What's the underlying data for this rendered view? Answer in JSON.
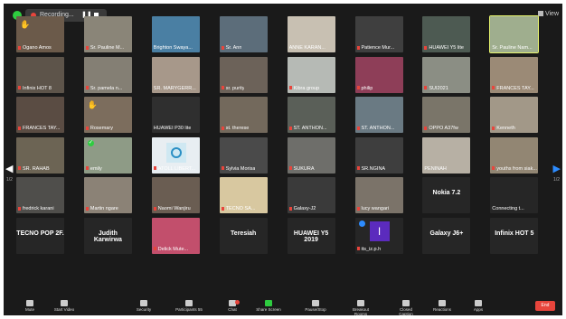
{
  "topbar": {
    "recording_label": "Recording...",
    "pause_glyph": "❚❚",
    "view_label": "View"
  },
  "participants": [
    {
      "name": "Ogano Amos",
      "muted": true,
      "bg": "#6b5a4a",
      "hand": true
    },
    {
      "name": "Sr. Pauline M...",
      "muted": true,
      "bg": "#8a8578"
    },
    {
      "name": "Brighton Swaya...",
      "muted": false,
      "bg": "#4a7fa3"
    },
    {
      "name": "Sr. Ann",
      "muted": true,
      "bg": "#5c6d7a"
    },
    {
      "name": "ANNE KARAN...",
      "muted": false,
      "bg": "#c8c0b2"
    },
    {
      "name": "Patience Mur...",
      "muted": true,
      "bg": "#3f3f3f"
    },
    {
      "name": "HUAWEI Y5 lite",
      "muted": true,
      "bg": "#4d5a52"
    },
    {
      "name": "Sr. Pauline Nam...",
      "muted": false,
      "bg": "#9fae8e",
      "highlight": true
    },
    {
      "name": "Infinix HOT 8",
      "muted": true,
      "bg": "#5d544a"
    },
    {
      "name": "Sr. pamela n...",
      "muted": true,
      "bg": "#847f74"
    },
    {
      "name": "SR. MARYGERR...",
      "muted": false,
      "bg": "#a7988a"
    },
    {
      "name": "sr. purity",
      "muted": true,
      "bg": "#6c6259"
    },
    {
      "name": "Kibra group",
      "muted": true,
      "bg": "#b6bab5"
    },
    {
      "name": "philip",
      "muted": true,
      "bg": "#8e3e58"
    },
    {
      "name": "SUI2021",
      "muted": true,
      "bg": "#8b8e84"
    },
    {
      "name": "FRANCES TAY...",
      "muted": true,
      "bg": "#9b8a76"
    },
    {
      "name": "FRANCES TAY...",
      "muted": true,
      "bg": "#5a4c43"
    },
    {
      "name": "Rosemary",
      "muted": true,
      "bg": "#7c6d5d",
      "hand": true
    },
    {
      "name": "HUAWEI P30 lite",
      "muted": false,
      "bg": "#2f2f2f"
    },
    {
      "name": "st. therese",
      "muted": true,
      "bg": "#73695c"
    },
    {
      "name": "ST. ANTHON...",
      "muted": true,
      "bg": "#5a5f58"
    },
    {
      "name": "ST. ANTHON...",
      "muted": true,
      "bg": "#6a7a83"
    },
    {
      "name": "OPPO A37fw",
      "muted": true,
      "bg": "#7a7569"
    },
    {
      "name": "Kenneth",
      "muted": true,
      "bg": "#a29888"
    },
    {
      "name": "SR. RAHAB",
      "muted": true,
      "bg": "#6c6454"
    },
    {
      "name": "emily",
      "muted": true,
      "bg": "#8e9b86",
      "check": true
    },
    {
      "name": "ATOLL LIBERT...",
      "muted": true,
      "bg": "#e8eef2",
      "qr": true
    },
    {
      "name": "Sylvia Morisa",
      "muted": true,
      "bg": "#4a4a4a"
    },
    {
      "name": "SUKURA",
      "muted": true,
      "bg": "#6e6e6a"
    },
    {
      "name": "SR.NGINA",
      "muted": true,
      "bg": "#3e3e3e"
    },
    {
      "name": "PENINAH",
      "muted": false,
      "bg": "#b7b0a4"
    },
    {
      "name": "youths from siak...",
      "muted": true,
      "bg": "#928673"
    },
    {
      "name": "fredrick karani",
      "muted": true,
      "bg": "#4f4e4b"
    },
    {
      "name": "Martin ngare",
      "muted": true,
      "bg": "#8b8276"
    },
    {
      "name": "Naomi Wanjiru",
      "muted": true,
      "bg": "#6a5d52"
    },
    {
      "name": "TECNO SA...",
      "muted": true,
      "bg": "#d8c8a0"
    },
    {
      "name": "Galaxy-J2",
      "muted": true,
      "bg": "#3a3a3a"
    },
    {
      "name": "lucy wangari",
      "muted": true,
      "bg": "#7b7369"
    },
    {
      "name": "Nokia 7.2",
      "muted": false,
      "bg": "#262626",
      "big": true
    },
    {
      "name": "Connecting t...",
      "muted": false,
      "bg": "#262626"
    },
    {
      "name": "TECNO POP 2F.",
      "muted": false,
      "bg": "#262626",
      "big": true
    },
    {
      "name": "Judith Karwirwa",
      "muted": false,
      "bg": "#262626",
      "big": true
    },
    {
      "name": "Delick Mute...",
      "muted": true,
      "bg": "#c24f6c"
    },
    {
      "name": "Teresiah",
      "muted": false,
      "bg": "#262626",
      "big": true
    },
    {
      "name": "HUAWEI Y5 2019",
      "muted": false,
      "bg": "#262626",
      "big": true
    },
    {
      "name": "its_iz.p.h",
      "muted": true,
      "bg": "#262626",
      "purple": true
    },
    {
      "name": "Galaxy J6+",
      "muted": false,
      "bg": "#262626",
      "big": true
    },
    {
      "name": "Infinix HOT 5",
      "muted": false,
      "bg": "#262626",
      "big": true
    }
  ],
  "purple_letter": "I",
  "pages": {
    "left": "1/2",
    "right": "1/2"
  },
  "bottombar": {
    "items": [
      {
        "label": "Mute",
        "name": "mute-button"
      },
      {
        "label": "Start Video",
        "name": "start-video-button"
      },
      {
        "label": "Security",
        "name": "security-button"
      },
      {
        "label": "Participants 55",
        "name": "participants-button"
      },
      {
        "label": "Chat",
        "name": "chat-button"
      },
      {
        "label": "Share Screen",
        "name": "share-screen-button",
        "green": true
      },
      {
        "label": "Pause/Stop",
        "name": "pause-stop-button"
      },
      {
        "label": "Breakout Rooms",
        "name": "breakout-rooms-button"
      },
      {
        "label": "Closed Caption",
        "name": "closed-caption-button"
      },
      {
        "label": "Reactions",
        "name": "reactions-button"
      },
      {
        "label": "Apps",
        "name": "apps-button"
      }
    ],
    "end_label": "End"
  },
  "colors": {
    "accent": "#2d8cff",
    "end": "#e8453c",
    "highlight": "#e8f56e"
  }
}
